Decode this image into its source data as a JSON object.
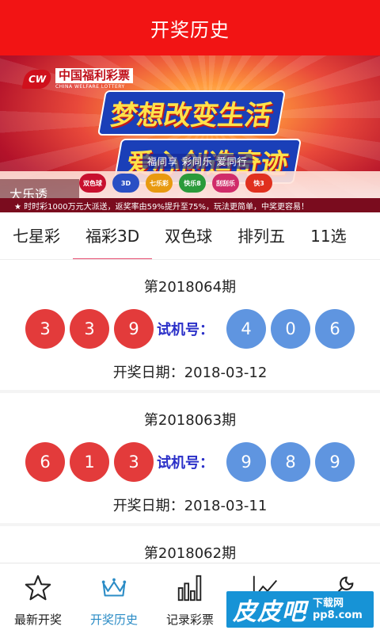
{
  "header": {
    "title": "开奖历史"
  },
  "banner": {
    "logo_cn": "中国福利彩票",
    "logo_en": "CHINA WELFARE LOTTERY",
    "slogan_line1": "梦想改变生活",
    "slogan_line2": "爱心创造奇迹",
    "sub_slogan": "福同享  彩同乐  爱同行",
    "lottery_label": "大乐透",
    "ticker": "★ 时时彩1000万元大派送，返奖率由59%提升至75%，玩法更简单，中奖更容易！",
    "game_icons": [
      {
        "name": "双色球",
        "color": "#c8102e"
      },
      {
        "name": "3D",
        "color": "#2a4fc4"
      },
      {
        "name": "七乐彩",
        "color": "#e89a10"
      },
      {
        "name": "快乐8",
        "color": "#2a9a3a"
      },
      {
        "name": "刮刮乐",
        "color": "#d02c6a"
      },
      {
        "name": "快3",
        "color": "#e0301e"
      }
    ]
  },
  "tabs": [
    {
      "label": "七星彩",
      "active": false
    },
    {
      "label": "福彩3D",
      "active": true
    },
    {
      "label": "双色球",
      "active": false
    },
    {
      "label": "排列五",
      "active": false
    },
    {
      "label": "11选",
      "active": false
    }
  ],
  "draws": [
    {
      "issue": "第2018064期",
      "numbers": [
        "3",
        "3",
        "9"
      ],
      "trial_label": "试机号：",
      "trial": [
        "4",
        "0",
        "6"
      ],
      "date_label": "开奖日期：",
      "date": "2018-03-12"
    },
    {
      "issue": "第2018063期",
      "numbers": [
        "6",
        "1",
        "3"
      ],
      "trial_label": "试机号：",
      "trial": [
        "9",
        "8",
        "9"
      ],
      "date_label": "开奖日期：",
      "date": "2018-03-11"
    },
    {
      "issue": "第2018062期",
      "numbers": [],
      "trial_label": "",
      "trial": [],
      "date_label": "",
      "date": ""
    }
  ],
  "bottom_nav": [
    {
      "label": "最新开奖",
      "icon": "star-icon",
      "active": false
    },
    {
      "label": "开奖历史",
      "icon": "crown-icon",
      "active": true
    },
    {
      "label": "记录彩票",
      "icon": "bar-chart-icon",
      "active": false
    },
    {
      "label": "",
      "icon": "trend-icon",
      "active": false
    },
    {
      "label": "",
      "icon": "wrench-icon",
      "active": false
    }
  ],
  "watermark": {
    "big": "皮皮吧",
    "small1": "下载网",
    "small2": "pp8.com"
  },
  "colors": {
    "header_red": "#f21414",
    "ball_red": "#e33b3b",
    "ball_blue": "#5f95e0",
    "trial_text": "#2a2fc8",
    "tab_underline": "#e64a6e",
    "nav_active": "#2b8cc6"
  }
}
